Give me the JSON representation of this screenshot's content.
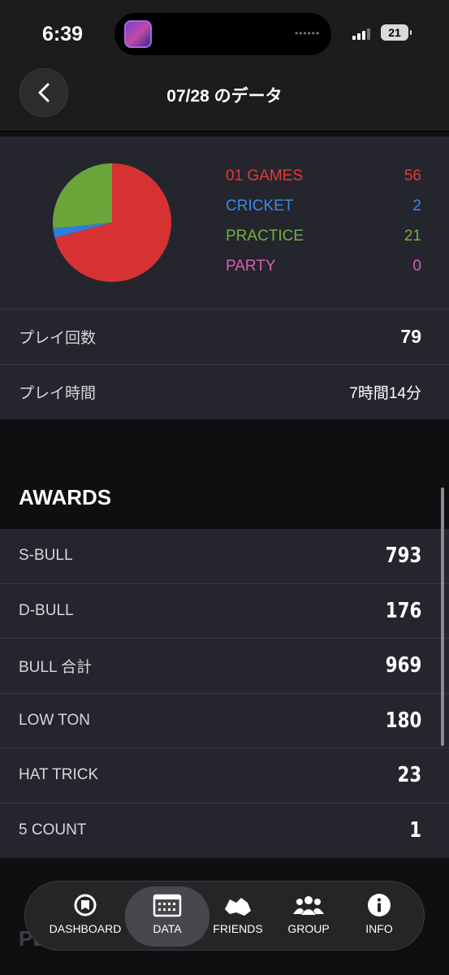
{
  "status_bar": {
    "time": "6:39",
    "battery": "21"
  },
  "header": {
    "title": "07/28 のデータ"
  },
  "chart_data": {
    "type": "pie",
    "categories": [
      "01 GAMES",
      "CRICKET",
      "PRACTICE",
      "PARTY"
    ],
    "values": [
      56,
      2,
      21,
      0
    ],
    "colors": [
      "#d63232",
      "#2f7de1",
      "#6aa63a",
      "#c95aa8"
    ]
  },
  "legend": [
    {
      "label": "01 GAMES",
      "value": "56",
      "color": "#e03a3a"
    },
    {
      "label": "CRICKET",
      "value": "2",
      "color": "#3a8ae8"
    },
    {
      "label": "PRACTICE",
      "value": "21",
      "color": "#72b043"
    },
    {
      "label": "PARTY",
      "value": "0",
      "color": "#d062b0"
    }
  ],
  "summary": {
    "play_count_label": "プレイ回数",
    "play_count": "79",
    "play_time_label": "プレイ時間",
    "play_time": "7時間14分"
  },
  "awards": {
    "title": "AWARDS",
    "items": [
      {
        "label": "S-BULL",
        "value": "793"
      },
      {
        "label": "D-BULL",
        "value": "176"
      },
      {
        "label": "BULL 合計",
        "value": "969"
      },
      {
        "label": "LOW TON",
        "value": "180"
      },
      {
        "label": "HAT TRICK",
        "value": "23"
      },
      {
        "label": "5 COUNT",
        "value": "1"
      }
    ]
  },
  "next_section_title": "PLAYED",
  "tabs": [
    {
      "label": "DASHBOARD",
      "icon": "dashboard-icon"
    },
    {
      "label": "DATA",
      "icon": "calendar-icon",
      "active": true
    },
    {
      "label": "FRIENDS",
      "icon": "friends-icon"
    },
    {
      "label": "GROUP",
      "icon": "group-icon"
    },
    {
      "label": "INFO",
      "icon": "info-icon"
    }
  ]
}
